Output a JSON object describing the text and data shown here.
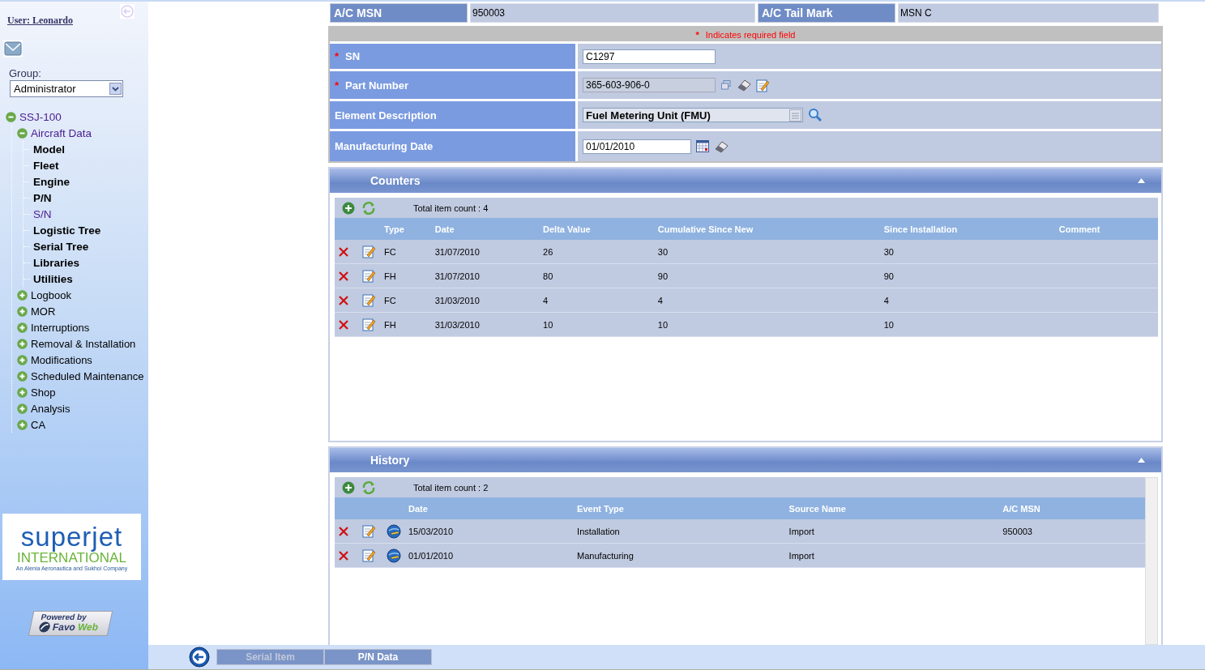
{
  "sidebar": {
    "user_link": "User: Leonardo",
    "group_label": "Group:",
    "group_value": "Administrator",
    "tree": [
      {
        "label": "SSJ-100",
        "expanded": true,
        "children": [
          {
            "label": "Aircraft Data",
            "expanded": true,
            "children": [
              {
                "label": "Model",
                "selected": false
              },
              {
                "label": "Fleet",
                "selected": false
              },
              {
                "label": "Engine",
                "selected": false
              },
              {
                "label": "P/N",
                "selected": false
              },
              {
                "label": "S/N",
                "selected": true
              },
              {
                "label": "Logistic Tree",
                "selected": false
              },
              {
                "label": "Serial Tree",
                "selected": false
              },
              {
                "label": "Libraries",
                "selected": false
              },
              {
                "label": "Utilities",
                "selected": false
              }
            ]
          },
          {
            "label": "Logbook",
            "expanded": false
          },
          {
            "label": "MOR",
            "expanded": false
          },
          {
            "label": "Interruptions",
            "expanded": false
          },
          {
            "label": "Removal & Installation",
            "expanded": false
          },
          {
            "label": "Modifications",
            "expanded": false
          },
          {
            "label": "Scheduled Maintenance",
            "expanded": false
          },
          {
            "label": "Shop",
            "expanded": false
          },
          {
            "label": "Analysis",
            "expanded": false
          },
          {
            "label": "CA",
            "expanded": false
          }
        ]
      }
    ],
    "logo": {
      "wordmark": "superjet",
      "name": "INTERNATIONAL",
      "tagline": "An Alenia Aeronautica and Sukhoi Company"
    },
    "powered_by": {
      "label": "Powered by",
      "brand_first": "Favo",
      "brand_second": "Web"
    }
  },
  "header": [
    {
      "label": "A/C MSN",
      "value": "950003"
    },
    {
      "label": "A/C Tail Mark",
      "value": "MSN C"
    }
  ],
  "required_note": {
    "mark": "*",
    "text": "Indicates required field"
  },
  "fields": [
    {
      "label": "SN",
      "required": true,
      "kind": "input",
      "value": "C1297"
    },
    {
      "label": "Part Number",
      "required": true,
      "kind": "readonly",
      "value": "365-603-906-0"
    },
    {
      "label": "Element Description",
      "required": false,
      "kind": "lookup",
      "value": "Fuel Metering Unit (FMU)"
    },
    {
      "label": "Manufacturing Date",
      "required": false,
      "kind": "date",
      "value": "01/01/2010"
    }
  ],
  "counters": {
    "title": "Counters",
    "expanded": true,
    "count": "Total item count : 4",
    "columns": [
      "Type",
      "Date",
      "Delta Value",
      "Cumulative Since New",
      "Since Installation",
      "Comment"
    ],
    "rows": [
      [
        "FC",
        "31/07/2010",
        "26",
        "30",
        "30",
        ""
      ],
      [
        "FH",
        "31/07/2010",
        "80",
        "90",
        "90",
        ""
      ],
      [
        "FC",
        "31/03/2010",
        "4",
        "4",
        "4",
        ""
      ],
      [
        "FH",
        "31/03/2010",
        "10",
        "10",
        "10",
        ""
      ]
    ]
  },
  "history": {
    "title": "History",
    "expanded": true,
    "count": "Total item count : 2",
    "columns": [
      "Date",
      "Event Type",
      "Source Name",
      "A/C MSN"
    ],
    "rows": [
      [
        "15/03/2010",
        "Installation",
        "Import",
        "950003"
      ],
      [
        "01/01/2010",
        "Manufacturing",
        "Import",
        ""
      ]
    ]
  },
  "bottom_tabs": [
    {
      "label": "Serial Item",
      "selected": true
    },
    {
      "label": "P/N Data",
      "selected": false
    }
  ]
}
